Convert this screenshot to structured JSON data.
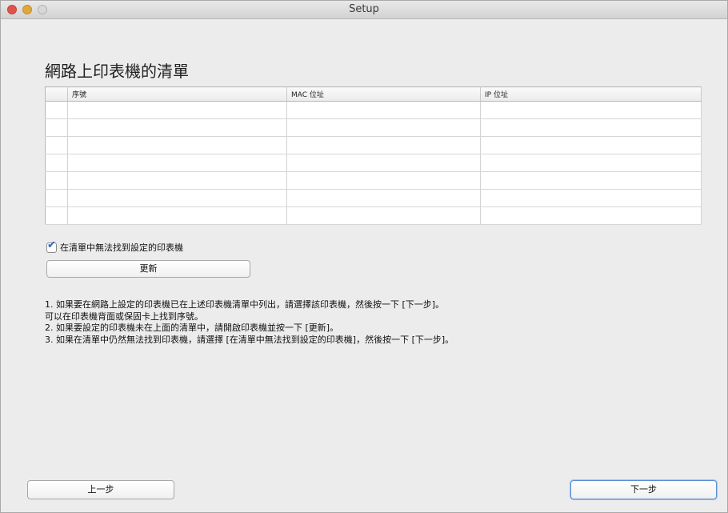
{
  "window": {
    "title": "Setup"
  },
  "page_title": "網路上印表機的清單",
  "table": {
    "columns": [
      "",
      "序號",
      "MAC 位址",
      "IP 位址"
    ],
    "row_count_visible": 7
  },
  "checkbox": {
    "label": "在清單中無法找到設定的印表機",
    "checked": true
  },
  "buttons": {
    "refresh": "更新",
    "back": "上一步",
    "next": "下一步"
  },
  "instructions": [
    "1. 如果要在網路上設定的印表機已在上述印表機清單中列出，請選擇該印表機，然後按一下 [下一步]。",
    "可以在印表機背面或保固卡上找到序號。",
    "2. 如果要設定的印表機未在上面的清單中，請開啟印表機並按一下 [更新]。",
    "3. 如果在清單中仍然無法找到印表機，請選擇 [在清單中無法找到設定的印表機]，然後按一下 [下一步]。"
  ],
  "colors": {
    "close_button": "#e0534b",
    "minimize_button": "#dfa93a",
    "check_mark": "#2a62c9",
    "default_button_border": "#5b8ed6"
  }
}
